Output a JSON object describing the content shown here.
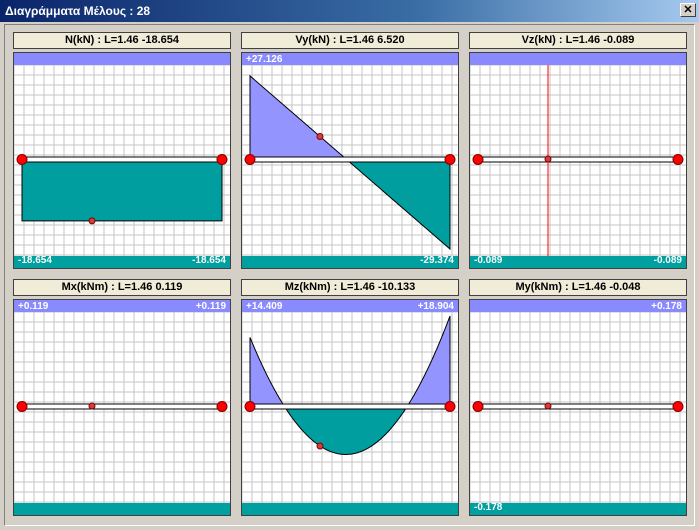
{
  "window": {
    "title": "Διαγράμματα Μέλους : 28",
    "close_glyph": "✕"
  },
  "colors": {
    "top_band": "#8a8aff",
    "bottom_band": "#00a0a0",
    "positive_fill": "#9494ff",
    "negative_fill": "#009e9e",
    "grid": "#c6c6c6",
    "node": "#ff0000",
    "marker_line": "#ff0000"
  },
  "panels": [
    {
      "title": "N(kN) : L=1.46 -18.654",
      "labels": {
        "top_left": "",
        "top_right": "",
        "bottom_left": "-18.654",
        "bottom_right": "-18.654"
      },
      "diagram": {
        "shape": "constant",
        "values": [
          -18.654,
          -18.654
        ],
        "scale_max": 27.126,
        "extreme_marker_at": 0.35
      }
    },
    {
      "title": "Vy(kN) : L=1.46 6.520",
      "labels": {
        "top_left": "+27.126",
        "top_right": "",
        "bottom_left": "",
        "bottom_right": "-29.374"
      },
      "diagram": {
        "shape": "linear",
        "values": [
          27.126,
          -29.374
        ],
        "scale_max": 29.374,
        "extreme_marker_at": 0.35
      }
    },
    {
      "title": "Vz(kN) : L=1.46 -0.089",
      "labels": {
        "top_left": "",
        "top_right": "",
        "bottom_left": "-0.089",
        "bottom_right": "-0.089"
      },
      "diagram": {
        "shape": "zero",
        "values": [
          0,
          0
        ],
        "scale_max": 1,
        "extreme_marker_at": 0.35,
        "vertical_marker_at": 0.35
      }
    },
    {
      "title": "Mx(kNm) : L=1.46 0.119",
      "labels": {
        "top_left": "+0.119",
        "top_right": "+0.119",
        "bottom_left": "",
        "bottom_right": ""
      },
      "diagram": {
        "shape": "zero",
        "values": [
          0,
          0
        ],
        "scale_max": 1,
        "extreme_marker_at": 0.35
      }
    },
    {
      "title": "Mz(kNm) : L=1.46 -10.133",
      "labels": {
        "top_left": "+14.409",
        "top_right": "+18.904",
        "bottom_left": "",
        "bottom_right": ""
      },
      "diagram": {
        "shape": "parabola",
        "values": [
          14.409,
          -10.133,
          18.904
        ],
        "scale_max": 18.904,
        "extreme_marker_at": 0.35
      }
    },
    {
      "title": "My(kNm) : L=1.46 -0.048",
      "labels": {
        "top_left": "",
        "top_right": "+0.178",
        "bottom_left": "-0.178",
        "bottom_right": ""
      },
      "diagram": {
        "shape": "zero",
        "values": [
          0,
          0
        ],
        "scale_max": 1,
        "extreme_marker_at": 0.35
      }
    }
  ]
}
